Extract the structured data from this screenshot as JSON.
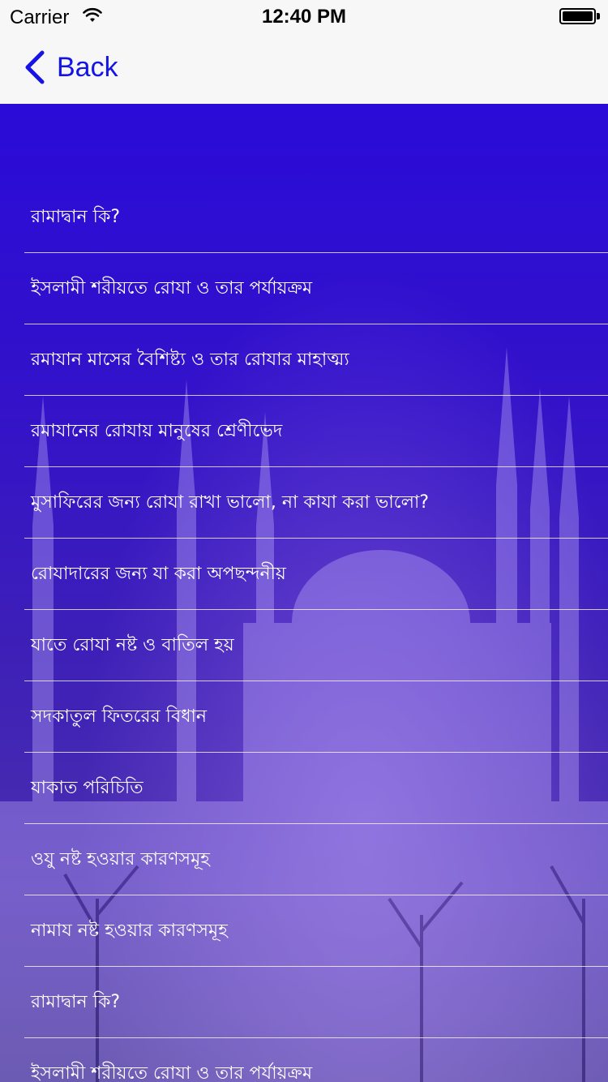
{
  "status_bar": {
    "carrier": "Carrier",
    "time": "12:40 PM",
    "wifi_icon": "wifi-icon",
    "battery_icon": "battery-icon"
  },
  "nav": {
    "back_label": "Back",
    "back_icon": "chevron-left-icon",
    "accent_color": "#1414e6"
  },
  "background": {
    "top_color": "#2a0bd8",
    "bottom_color": "#3a2a8a"
  },
  "list": {
    "items": [
      {
        "label": "রামাদ্বান কি?"
      },
      {
        "label": "ইসলামী শরীয়তে রোযা ও তার পর্যায়ক্রম"
      },
      {
        "label": "রমাযান মাসের বৈশিষ্ট্য ও তার রোযার মাহাত্ম্য"
      },
      {
        "label": "রমাযানের রোযায় মানুষের শ্রেণীভেদ"
      },
      {
        "label": "মুসাফিরের জন্য রোযা রাখা ভালো, না কাযা করা ভালো?"
      },
      {
        "label": "রোযাদারের জন্য যা করা অপছন্দনীয়"
      },
      {
        "label": "যাতে রোযা নষ্ট ও বাতিল হয়"
      },
      {
        "label": "সদকাতুল ফিতরের বিধান"
      },
      {
        "label": "যাকাত পরিচিতি"
      },
      {
        "label": "ওযু নষ্ট হওয়ার কারণসমূহ"
      },
      {
        "label": "নামায নষ্ট হওয়ার কারণসমূহ"
      },
      {
        "label": "রামাদ্বান কি?"
      },
      {
        "label": "ইসলামী শরীয়তে রোযা ও তার পর্যায়ক্রম"
      }
    ]
  }
}
